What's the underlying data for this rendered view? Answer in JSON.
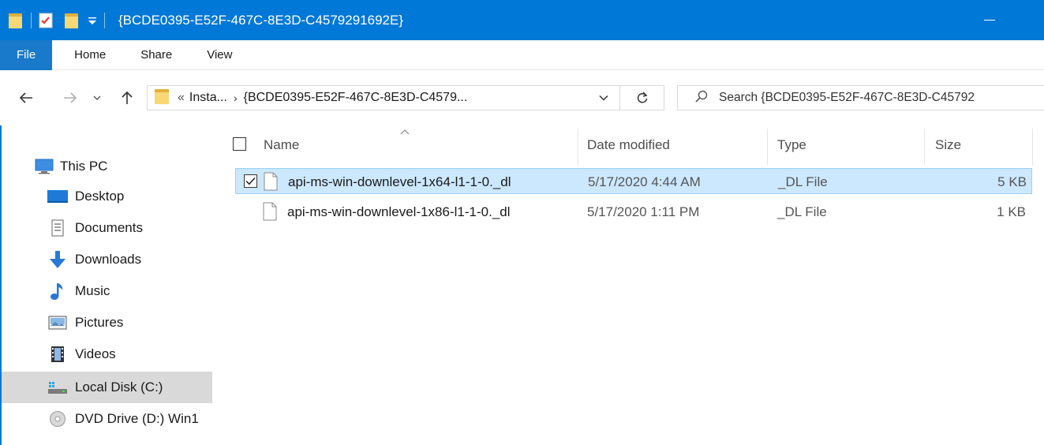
{
  "window": {
    "title": "{BCDE0395-E52F-467C-8E3D-C4579291692E}"
  },
  "ribbon": {
    "tabs": [
      "File",
      "Home",
      "Share",
      "View"
    ]
  },
  "address": {
    "overflow": "«",
    "segment1": "Insta...",
    "separator": "›",
    "segment2": "{BCDE0395-E52F-467C-8E3D-C4579..."
  },
  "search": {
    "placeholder": "Search {BCDE0395-E52F-467C-8E3D-C45792"
  },
  "sidebar": {
    "items": [
      {
        "label": "This PC",
        "icon": "pc-icon"
      },
      {
        "label": "Desktop",
        "icon": "desktop-icon"
      },
      {
        "label": "Documents",
        "icon": "documents-icon"
      },
      {
        "label": "Downloads",
        "icon": "downloads-icon"
      },
      {
        "label": "Music",
        "icon": "music-icon"
      },
      {
        "label": "Pictures",
        "icon": "pictures-icon"
      },
      {
        "label": "Videos",
        "icon": "videos-icon"
      },
      {
        "label": "Local Disk (C:)",
        "icon": "local-disk-icon",
        "selected": true
      },
      {
        "label": "DVD Drive (D:) Win1",
        "icon": "dvd-drive-icon"
      }
    ]
  },
  "columns": {
    "name": "Name",
    "date": "Date modified",
    "type": "Type",
    "size": "Size"
  },
  "files": [
    {
      "name": "api-ms-win-downlevel-1x64-l1-1-0._dl",
      "date": "5/17/2020 4:44 AM",
      "type": "_DL File",
      "size": "5 KB",
      "selected": true
    },
    {
      "name": "api-ms-win-downlevel-1x86-l1-1-0._dl",
      "date": "5/17/2020 1:11 PM",
      "type": "_DL File",
      "size": "1 KB",
      "selected": false
    }
  ],
  "colors": {
    "titlebar": "#0078d7",
    "file_tab": "#1979ca",
    "selection": "#cce8ff",
    "nav_selected": "#d9d9d9"
  }
}
